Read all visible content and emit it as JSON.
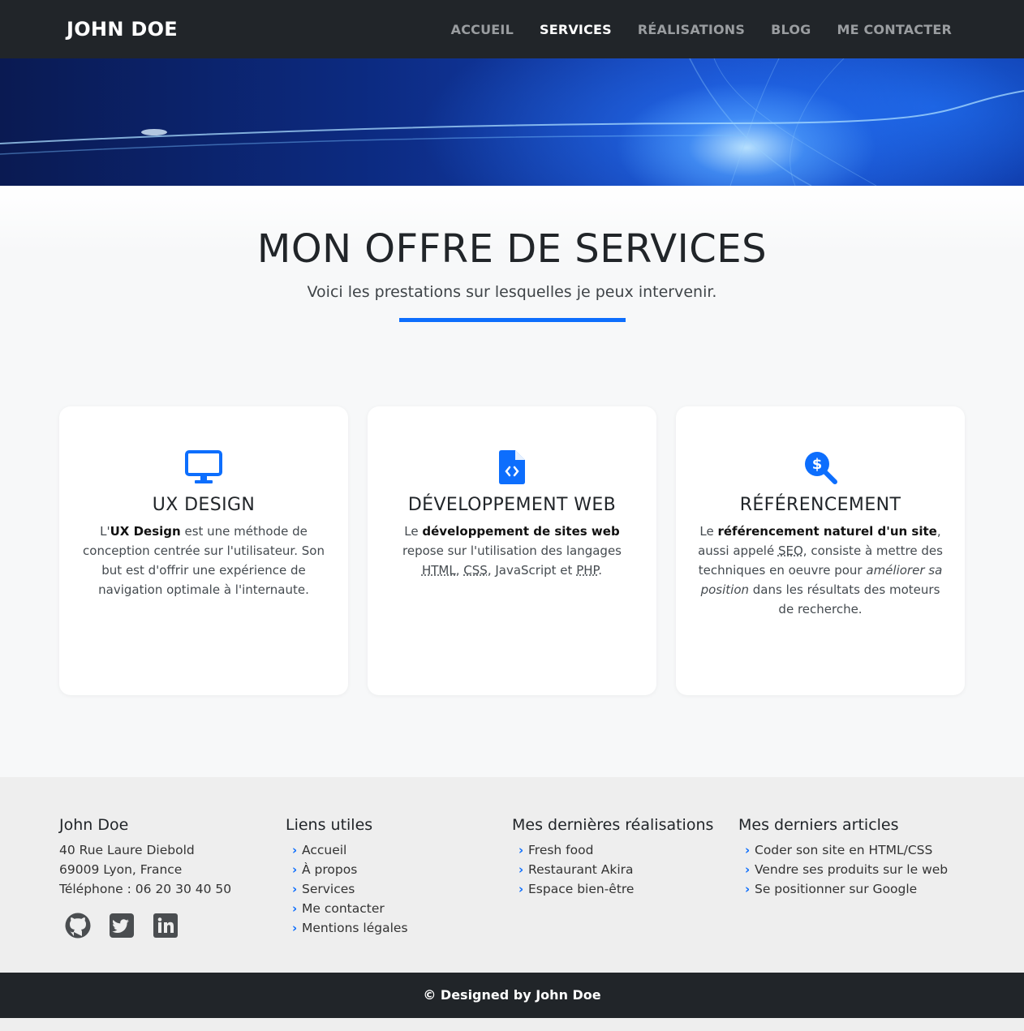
{
  "nav": {
    "brand": "JOHN DOE",
    "items": [
      {
        "label": "ACCUEIL",
        "active": false
      },
      {
        "label": "SERVICES",
        "active": true
      },
      {
        "label": "RÉALISATIONS",
        "active": false
      },
      {
        "label": "BLOG",
        "active": false
      },
      {
        "label": "ME CONTACTER",
        "active": false
      }
    ]
  },
  "services": {
    "title": "MON OFFRE DE SERVICES",
    "subtitle": "Voici les prestations sur lesquelles je peux intervenir.",
    "cards": [
      {
        "icon": "desktop-icon",
        "title": "UX DESIGN",
        "t1": "L'",
        "b1": "UX Design",
        "t2": " est une méthode de conception centrée sur l'utilisateur. Son but est d'offrir une expérience de navigation optimale à l'internaute."
      },
      {
        "icon": "file-code-icon",
        "title": "DÉVELOPPEMENT WEB",
        "t1": "Le ",
        "b1": "développement de sites web",
        "t2": " repose sur l'utilisation des langages ",
        "a1": "HTML",
        "t3": ", ",
        "a2": "CSS",
        "t4": ", JavaScript et ",
        "a3": "PHP",
        "t5": "."
      },
      {
        "icon": "search-dollar-icon",
        "title": "RÉFÉRENCEMENT",
        "t1": "Le ",
        "b1": "référencement naturel d'un site",
        "t2": ", aussi appelé ",
        "a1": "SEO",
        "t3": ", consiste à mettre des techniques en oeuvre pour ",
        "i1": "améliorer sa position",
        "t4": " dans les résultats des moteurs de recherche."
      }
    ]
  },
  "footer": {
    "contact": {
      "title": "John Doe",
      "address1": "40 Rue Laure Diebold",
      "address2": "69009 Lyon, France",
      "phone": "Téléphone : 06 20 30 40 50",
      "socials": [
        "github-icon",
        "twitter-icon",
        "linkedin-icon"
      ]
    },
    "links": {
      "title": "Liens utiles",
      "items": [
        "Accueil",
        "À propos",
        "Services",
        "Me contacter",
        "Mentions légales"
      ]
    },
    "works": {
      "title": "Mes dernières réalisations",
      "items": [
        "Fresh food",
        "Restaurant Akira",
        "Espace bien-être"
      ]
    },
    "articles": {
      "title": "Mes derniers articles",
      "items": [
        "Coder son site en HTML/CSS",
        "Vendre ses produits sur le web",
        "Se positionner sur Google"
      ]
    },
    "copyright": "© Designed by John Doe"
  },
  "colors": {
    "accent": "#0d6efd",
    "navbar": "#212529",
    "footer_bg": "#eeeeee"
  }
}
